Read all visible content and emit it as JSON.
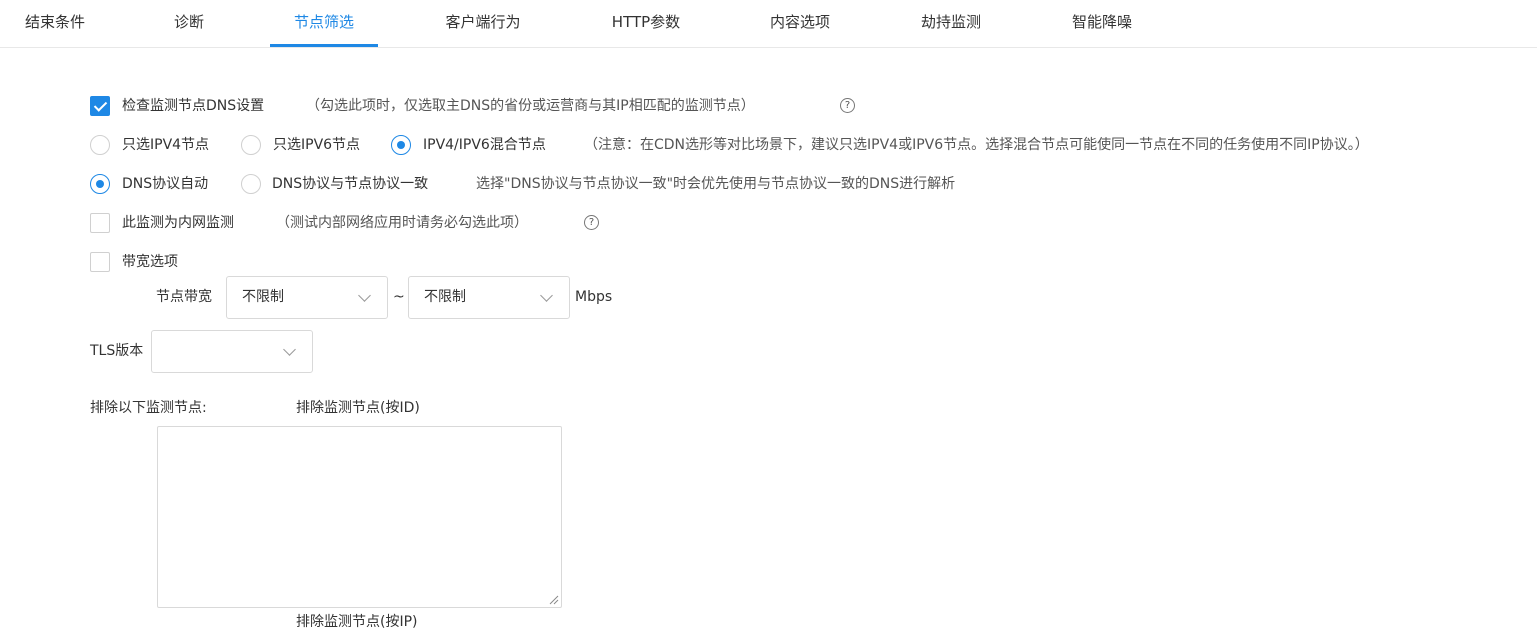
{
  "tabs": [
    {
      "label": "结束条件"
    },
    {
      "label": "诊断"
    },
    {
      "label": "节点筛选"
    },
    {
      "label": "客户端行为"
    },
    {
      "label": "HTTP参数"
    },
    {
      "label": "内容选项"
    },
    {
      "label": "劫持监测"
    },
    {
      "label": "智能降噪"
    }
  ],
  "active_tab": "节点筛选",
  "accent_color": "#1e88e5",
  "dns_check": {
    "label": "检查监测节点DNS设置",
    "checked": true,
    "note": "（勾选此项时，仅选取主DNS的省份或运营商与其IP相匹配的监测节点）",
    "help_icon": "?"
  },
  "ip_version": {
    "options": [
      "只选IPV4节点",
      "只选IPV6节点",
      "IPV4/IPV6混合节点"
    ],
    "selected": "IPV4/IPV6混合节点",
    "note": "（注意：在CDN选形等对比场景下，建议只选IPV4或IPV6节点。选择混合节点可能使同一节点在不同的任务使用不同IP协议。）"
  },
  "dns_protocol": {
    "options": [
      "DNS协议自动",
      "DNS协议与节点协议一致"
    ],
    "selected": "DNS协议自动",
    "note": "选择\"DNS协议与节点协议一致\"时会优先使用与节点协议一致的DNS进行解析"
  },
  "intranet": {
    "label": "此监测为内网监测",
    "checked": false,
    "note": "（测试内部网络应用时请务必勾选此项）",
    "help_icon": "?"
  },
  "bandwidth": {
    "label": "带宽选项",
    "checked": false,
    "node_bandwidth_label": "节点带宽",
    "min_value": "不限制",
    "separator": "~",
    "max_value": "不限制",
    "unit": "Mbps"
  },
  "tls": {
    "label": "TLS版本",
    "value": ""
  },
  "exclude": {
    "label": "排除以下监测节点:",
    "by_id_label": "排除监测节点(按ID)",
    "by_id_value": "",
    "by_ip_label": "排除监测节点(按IP)"
  }
}
